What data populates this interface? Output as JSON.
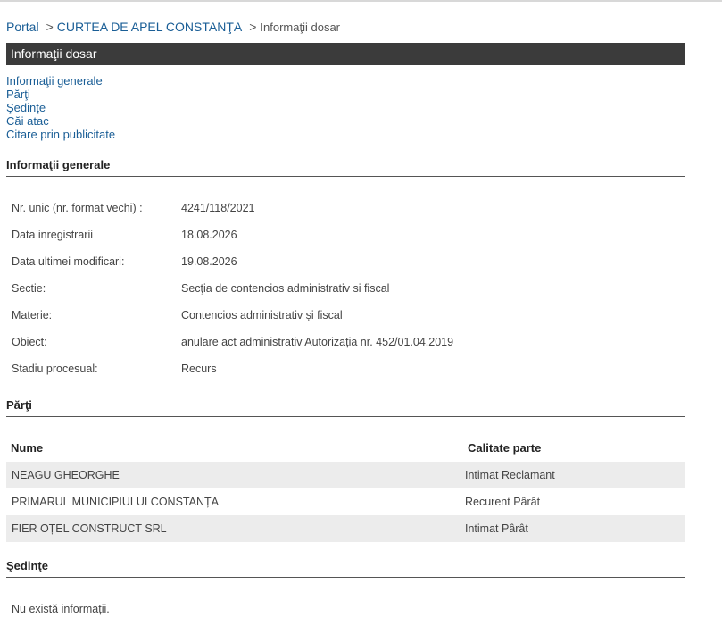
{
  "breadcrumb": {
    "portal": "Portal",
    "court": "CURTEA DE APEL CONSTANŢA",
    "current": "Informaţii dosar",
    "separator": ">"
  },
  "title_bar": "Informaţii dosar",
  "nav": [
    "Informaţii generale",
    "Părţi",
    "Şedinţe",
    "Căi atac",
    "Citare prin publicitate"
  ],
  "sections": {
    "general": "Informaţii generale",
    "parti": "Părţi",
    "sedinte": "Şedinţe"
  },
  "general_info": [
    {
      "label": "Nr. unic (nr. format vechi) :",
      "value": "4241/118/2021"
    },
    {
      "label": "Data inregistrarii",
      "value": "18.08.2026"
    },
    {
      "label": "Data ultimei modificari:",
      "value": "19.08.2026"
    },
    {
      "label": "Sectie:",
      "value": "Secţia de contencios administrativ si fiscal"
    },
    {
      "label": "Materie:",
      "value": "Contencios administrativ și fiscal"
    },
    {
      "label": "Obiect:",
      "value": "anulare act administrativ Autorizația nr. 452/01.04.2019"
    },
    {
      "label": "Stadiu procesual:",
      "value": "Recurs"
    }
  ],
  "parti_table": {
    "headers": {
      "name": "Nume",
      "role": "Calitate parte"
    },
    "rows": [
      {
        "name": "NEAGU GHEORGHE",
        "role": "Intimat Reclamant"
      },
      {
        "name": "PRIMARUL MUNICIPIULUI CONSTANȚA",
        "role": "Recurent Pârât"
      },
      {
        "name": "FIER OȚEL CONSTRUCT SRL",
        "role": "Intimat Pârât"
      }
    ]
  },
  "sedinte_empty": "Nu există informații."
}
